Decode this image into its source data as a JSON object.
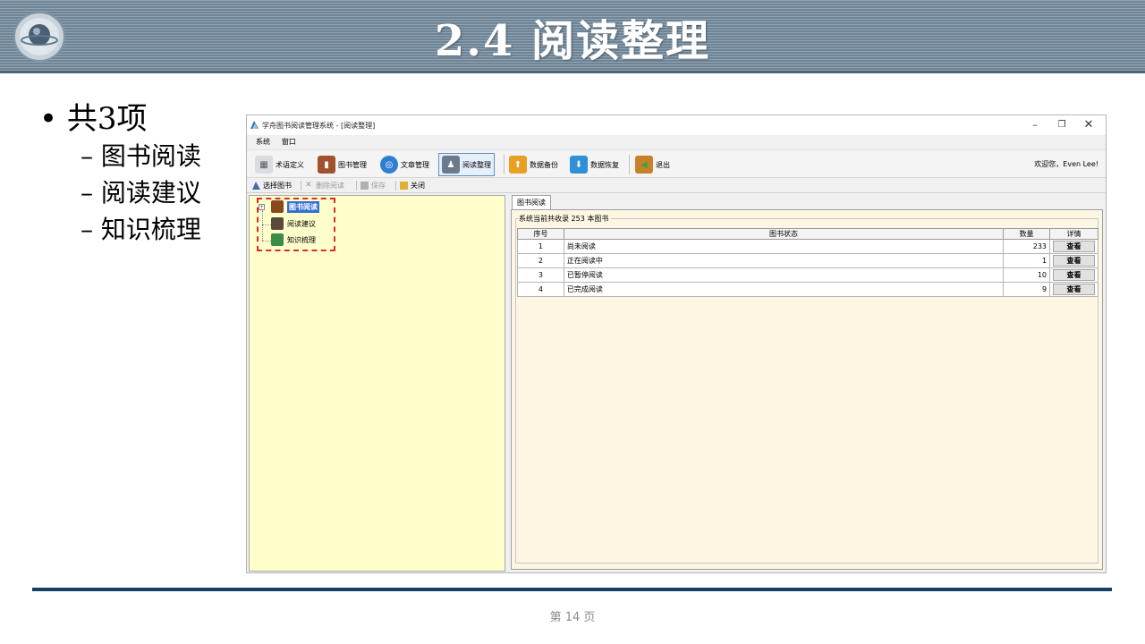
{
  "slide": {
    "title": "2.4  阅读整理",
    "bullet_main": "• 共3项",
    "bullet_subs": [
      "– 图书阅读",
      "– 阅读建议",
      "– 知识梳理"
    ],
    "page_number": "第 14 页"
  },
  "app": {
    "window_title": "学舟图书阅读管理系统 - [阅读整理]",
    "window_buttons": {
      "minimize": "–",
      "restore": "❐",
      "close": "✕"
    },
    "menu": [
      "系统",
      "窗口"
    ],
    "toolbar": [
      {
        "label": "术语定义",
        "icon": "definition-icon"
      },
      {
        "label": "图书管理",
        "icon": "book-icon"
      },
      {
        "label": "文章管理",
        "icon": "globe-icon"
      },
      {
        "label": "阅读整理",
        "icon": "reader-icon",
        "active": true
      },
      {
        "label": "数据备份",
        "icon": "backup-icon"
      },
      {
        "label": "数据恢复",
        "icon": "restore-icon"
      },
      {
        "label": "退出",
        "icon": "exit-icon"
      }
    ],
    "welcome": "欢迎您，Even Lee!",
    "toolbar2": [
      {
        "label": "选择图书",
        "enabled": true
      },
      {
        "label": "删除阅读",
        "enabled": false
      },
      {
        "label": "保存",
        "enabled": false
      },
      {
        "label": "关闭",
        "enabled": true
      }
    ],
    "tree": [
      {
        "label": "图书阅读",
        "selected": true,
        "expander": "+"
      },
      {
        "label": "阅读建议",
        "selected": false
      },
      {
        "label": "知识梳理",
        "selected": false
      }
    ],
    "tab_label": "图书阅读",
    "summary": "系统当前共收录 253 本图书",
    "table": {
      "headers": [
        "序号",
        "图书状态",
        "数量",
        "详情"
      ],
      "rows": [
        {
          "no": "1",
          "status": "尚未阅读",
          "qty": "233",
          "detail": "查看"
        },
        {
          "no": "2",
          "status": "正在阅读中",
          "qty": "1",
          "detail": "查看"
        },
        {
          "no": "3",
          "status": "已暂停阅读",
          "qty": "10",
          "detail": "查看"
        },
        {
          "no": "4",
          "status": "已完成阅读",
          "qty": "9",
          "detail": "查看"
        }
      ]
    },
    "colors": {
      "tree_bg": "#ffffcc",
      "content_bg": "#fdf6e3",
      "highlight": "#d92b2b",
      "selected": "#3370d4"
    }
  }
}
